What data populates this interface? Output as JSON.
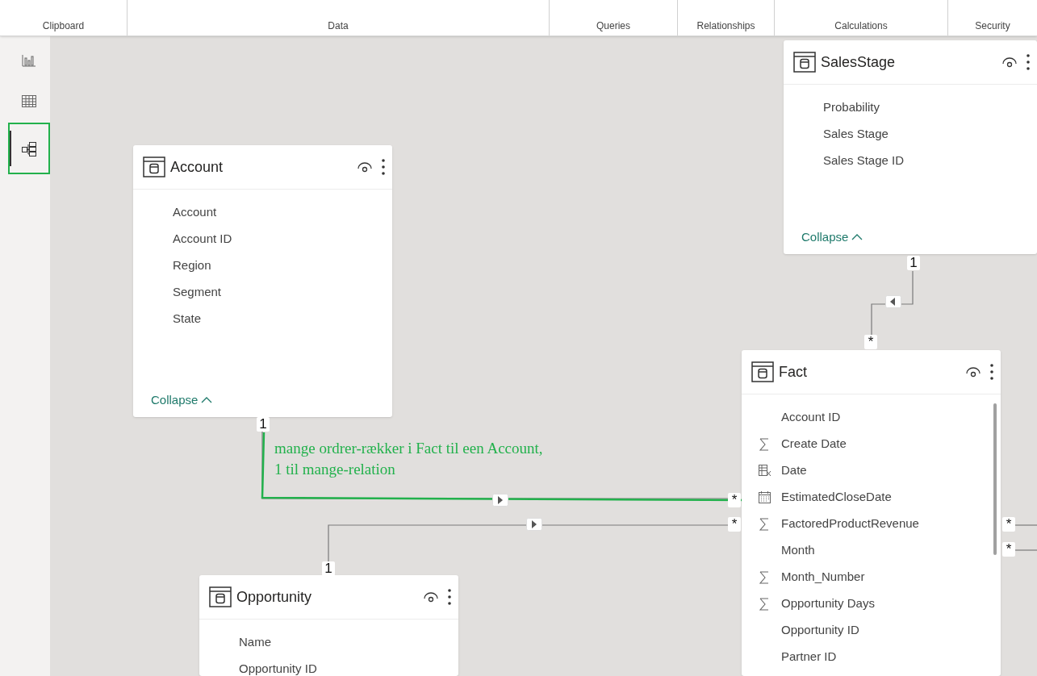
{
  "ribbon_groups": [
    "Clipboard",
    "Data",
    "Queries",
    "Relationships",
    "Calculations",
    "Security"
  ],
  "nav": [
    {
      "kind": "report",
      "selected": false
    },
    {
      "kind": "table",
      "selected": false
    },
    {
      "kind": "model",
      "selected": true
    }
  ],
  "tables": [
    {
      "name": "Account",
      "fields": [
        {
          "name": "Account",
          "kind": "plain"
        },
        {
          "name": "Account ID",
          "kind": "plain"
        },
        {
          "name": "Region",
          "kind": "plain"
        },
        {
          "name": "Segment",
          "kind": "plain"
        },
        {
          "name": "State",
          "kind": "plain"
        }
      ],
      "collapse": "Collapse"
    },
    {
      "name": "SalesStage",
      "fields": [
        {
          "name": "Probability",
          "kind": "plain"
        },
        {
          "name": "Sales Stage",
          "kind": "plain"
        },
        {
          "name": "Sales Stage ID",
          "kind": "plain"
        }
      ],
      "collapse": "Collapse"
    },
    {
      "name": "Fact",
      "fields": [
        {
          "name": "Account ID",
          "kind": "plain"
        },
        {
          "name": "Create Date",
          "kind": "sum"
        },
        {
          "name": "Date",
          "kind": "calculated"
        },
        {
          "name": "EstimatedCloseDate",
          "kind": "date"
        },
        {
          "name": "FactoredProductRevenue",
          "kind": "sum"
        },
        {
          "name": "Month",
          "kind": "plain"
        },
        {
          "name": "Month_Number",
          "kind": "sum"
        },
        {
          "name": "Opportunity Days",
          "kind": "sum"
        },
        {
          "name": "Opportunity ID",
          "kind": "plain"
        },
        {
          "name": "Partner ID",
          "kind": "plain"
        }
      ]
    },
    {
      "name": "Opportunity",
      "fields": [
        {
          "name": "Name",
          "kind": "plain"
        },
        {
          "name": "Opportunity ID",
          "kind": "plain"
        }
      ]
    }
  ],
  "relationships": [
    {
      "one": "1",
      "many": "*",
      "kind": "right"
    },
    {
      "one": "1",
      "many": "*",
      "kind": "right"
    },
    {
      "one": "1",
      "many": "*",
      "kind": "left"
    },
    {
      "many": "*",
      "kind": "offscreen"
    },
    {
      "many": "*",
      "kind": "offscreen"
    }
  ],
  "annotation": "mange ordrer-rækker i Fact til een Account,\n1 til mange-relation"
}
